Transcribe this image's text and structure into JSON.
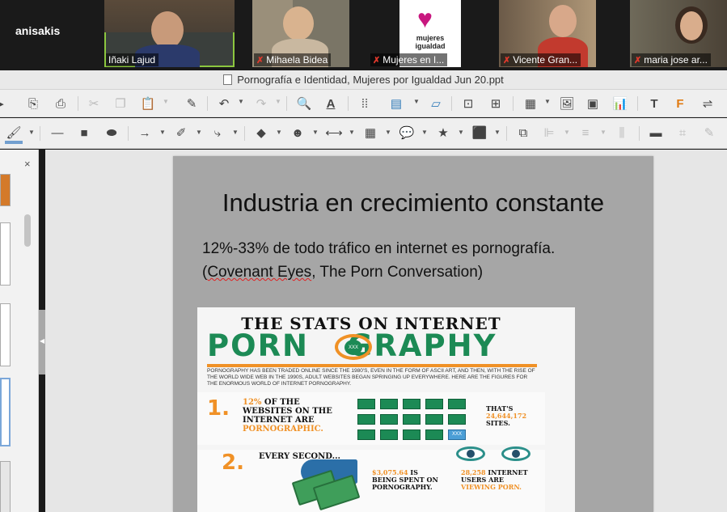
{
  "meeting": {
    "self_name": "anisakis",
    "participants": [
      {
        "name": "Iñaki Lajud",
        "muted": false,
        "active": true,
        "bg": "#3a3f3c"
      },
      {
        "name": "Mihaela Bidea",
        "muted": true,
        "active": false,
        "bg": "#7a7566"
      },
      {
        "name": "Mujeres en I...",
        "muted": true,
        "active": false,
        "bg": "#ffffff",
        "logo_text": "mujeres igualdad"
      },
      {
        "name": "Vicente Gran...",
        "muted": true,
        "active": false,
        "bg": "#8a6f55"
      },
      {
        "name": "maria jose ar...",
        "muted": true,
        "active": false,
        "bg": "#6a5a48"
      }
    ]
  },
  "window": {
    "title": "Pornografía e Identidad, Mujeres por Igualdad Jun 20.ppt"
  },
  "toolbar1": {
    "icons": [
      "export-icon",
      "print-icon",
      "cut-icon",
      "copy-icon",
      "paste-icon",
      "clone-format-icon",
      "undo-icon",
      "redo-icon",
      "find-icon",
      "spelling-icon",
      "grid-icon",
      "layout-icon",
      "slide-icon",
      "start-slideshow-icon",
      "presenter-icon",
      "table-icon",
      "image-icon",
      "media-icon",
      "chart-icon",
      "textbox-icon",
      "fontwork-icon",
      "special-char-icon"
    ]
  },
  "toolbar2": {
    "icons": [
      "fill-color-icon",
      "line-icon",
      "rectangle-icon",
      "ellipse-icon",
      "arrow-line-icon",
      "curve-icon",
      "connector-icon",
      "basic-shapes-icon",
      "symbol-shapes-icon",
      "block-arrows-icon",
      "flowchart-icon",
      "callout-icon",
      "star-icon",
      "3d-object-icon",
      "transform-icon",
      "align-icon",
      "arrange-icon",
      "distribute-icon",
      "shadow-icon",
      "crop-icon",
      "edit-points-icon"
    ]
  },
  "slide_pane": {
    "close_label": "×"
  },
  "slide": {
    "title": "Industria en crecimiento constante",
    "line1": "12%-33% de todo tráfico en internet es pornografía.",
    "line2_prefix": "(",
    "line2_flagged": "Covenant Eyes",
    "line2_suffix": ", The Porn Conversation)"
  },
  "infographic": {
    "heading1": "THE STATS ON INTERNET",
    "heading2_a": "PORN",
    "heading2_b": "GRAPHY",
    "eye_label": "XXX",
    "intro": "Pornography has been traded online since the 1980's, even in the form of ASCII art, and then, with the rise of the world wide web in the 1990s, adult websites began springing up everywhere. Here are the figures for the enormous world of internet pornography.",
    "stat1_num": "1.",
    "stat1_a": "12%",
    "stat1_b": "of the",
    "stat1_c": "websites on the",
    "stat1_d": "internet are",
    "stat1_e": "pornographic.",
    "stat1_side_a": "That's",
    "stat1_side_b": "24,644,172",
    "stat1_side_c": "sites.",
    "box_label": "XXX",
    "stat2_num": "2.",
    "stat2_title": "Every second...",
    "stat2_money_a": "$3,075.64",
    "stat2_money_b": "is",
    "stat2_money_c": "being spent on",
    "stat2_money_d": "pornography.",
    "stat2_users_a": "28,258",
    "stat2_users_b": "internet",
    "stat2_users_c": "users are",
    "stat2_users_d": "viewing porn."
  }
}
